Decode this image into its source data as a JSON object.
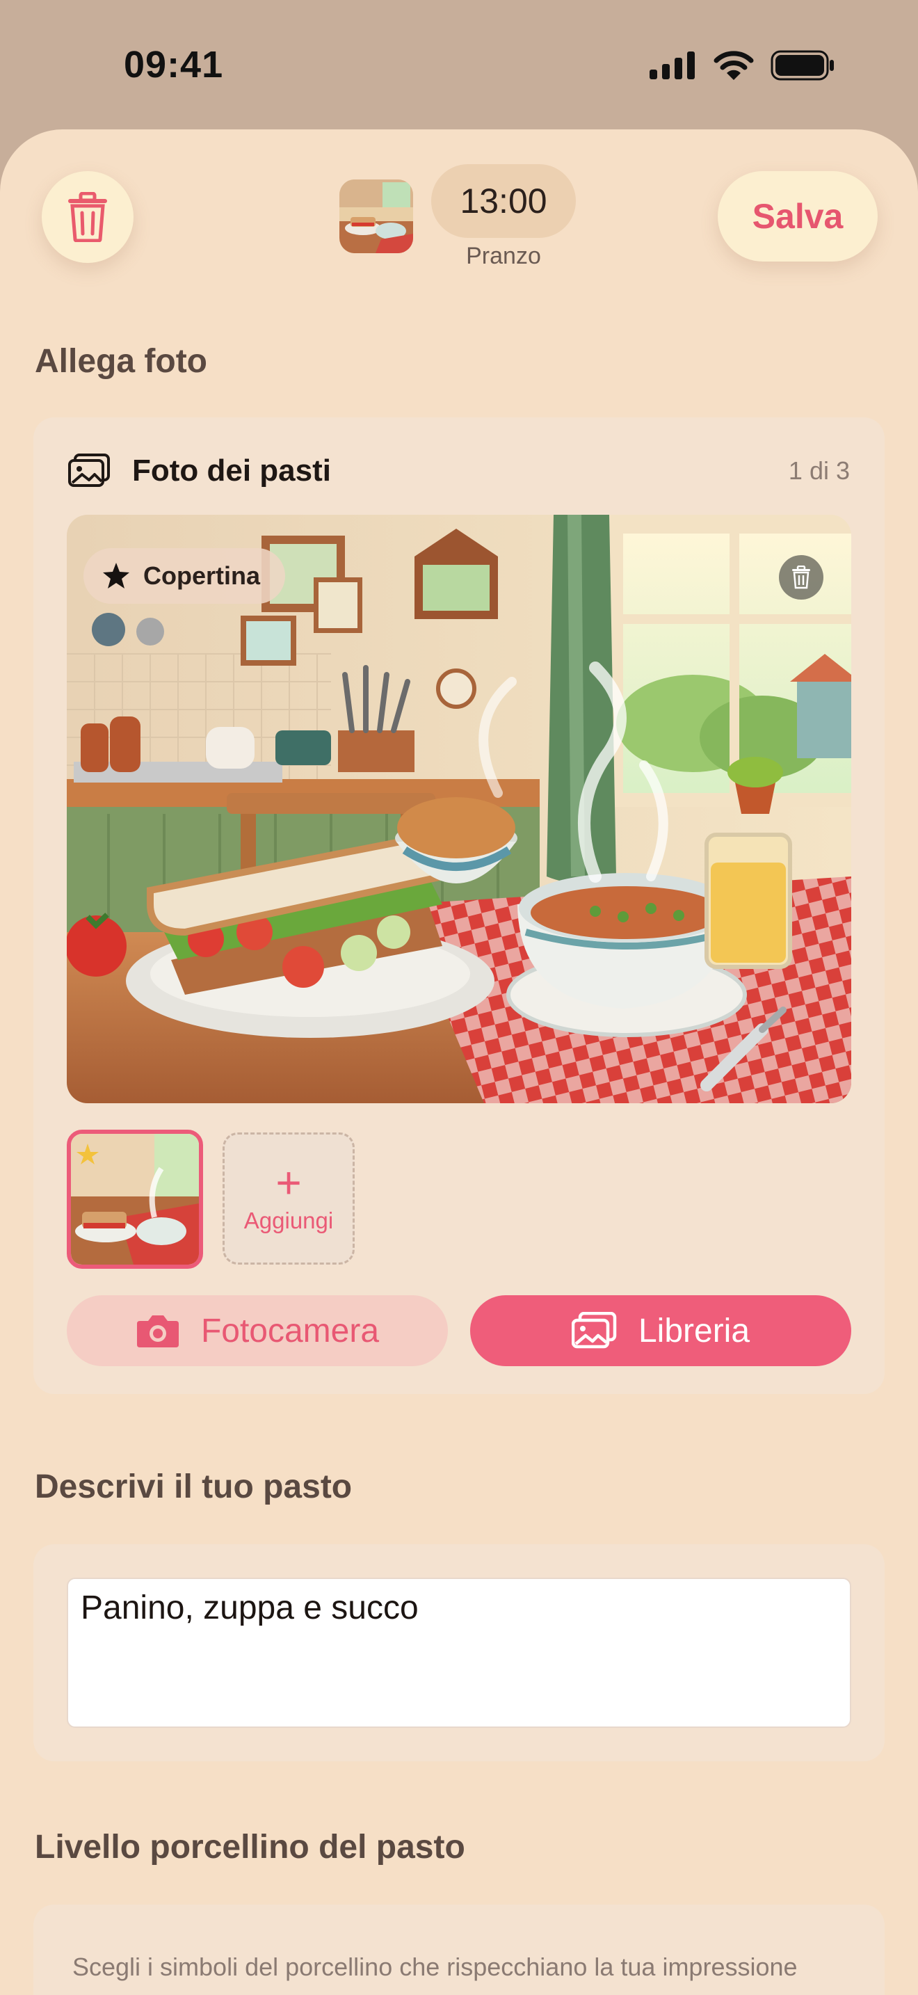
{
  "status_bar": {
    "time": "09:41"
  },
  "header": {
    "time": "13:00",
    "meal_type": "Pranzo",
    "save_label": "Salva"
  },
  "photos_section": {
    "title": "Allega foto",
    "card_title": "Foto dei pasti",
    "count": "1 di 3",
    "cover_label": "Copertina",
    "add_label": "Aggiungi",
    "camera_label": "Fotocamera",
    "library_label": "Libreria"
  },
  "describe_section": {
    "title": "Descrivi il tuo pasto",
    "description_value": "Panino, zuppa e succo"
  },
  "level_section": {
    "title": "Livello porcellino del pasto",
    "help_text": "Scegli i simboli del porcellino che rispecchiano la tua impressione"
  },
  "colors": {
    "accent": "#EF5D7A",
    "sheet_background": "#F6DFC6",
    "card_background": "#F4E2D0"
  },
  "icons": [
    "trash-icon",
    "photos-icon",
    "star-icon",
    "camera-icon",
    "library-icon",
    "signal-icon",
    "wifi-icon",
    "battery-icon"
  ]
}
